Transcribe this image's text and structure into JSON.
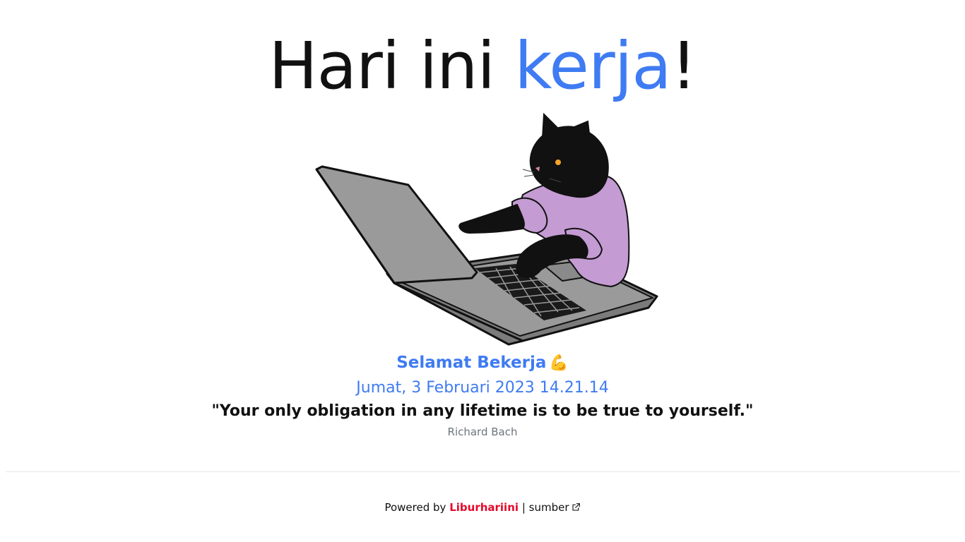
{
  "headline": {
    "prefix": "Hari ini",
    "highlight": "kerja",
    "suffix": "!"
  },
  "illustration": {
    "name": "cat-working-on-laptop-illustration"
  },
  "greeting": {
    "text": "Selamat Bekerja",
    "emoji": "💪"
  },
  "datetime": "Jumat, 3 Februari 2023 14.21.14",
  "quote": {
    "text": "\"Your only obligation in any lifetime is to be true to yourself.\"",
    "author": "Richard Bach"
  },
  "footer": {
    "powered_by": "Powered by",
    "brand": "Liburhariini",
    "separator": "|",
    "source_label": "sumber",
    "source_icon": "external-link-icon"
  },
  "colors": {
    "accent": "#3f7bf2",
    "brand": "#e4092b",
    "muted": "#6c757d"
  }
}
